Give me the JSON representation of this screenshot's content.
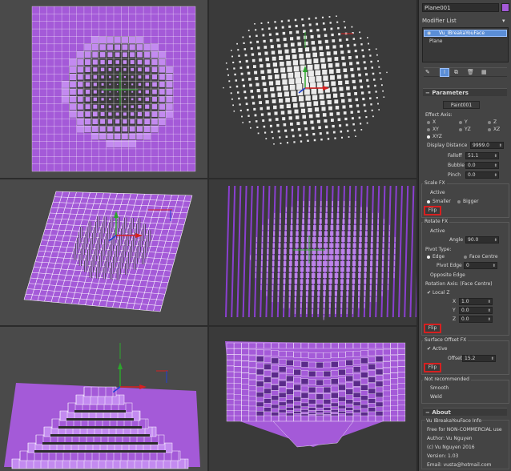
{
  "panel": {
    "object_name": "Plane001",
    "object_color": "#a45ad8",
    "modifier_list_label": "Modifier List",
    "stack": [
      "Vu_IBreakaYouFace",
      "Plane"
    ],
    "params_title": "Parameters",
    "paint_button": "Paint001",
    "effect_axis_label": "Effect Axis:",
    "axes": {
      "x": "X",
      "y": "Y",
      "z": "Z",
      "xy": "XY",
      "yz": "YZ",
      "xz": "XZ",
      "xyz": "XYZ"
    },
    "display_distance": {
      "label": "Display Distance",
      "value": "9999.0"
    },
    "falloff": {
      "label": "Falloff",
      "value": "51.1"
    },
    "bubble": {
      "label": "Bubble",
      "value": "0.0"
    },
    "pinch": {
      "label": "Pinch",
      "value": "0.0"
    },
    "scale_fx": {
      "title": "Scale FX",
      "active": "Active",
      "smaller": "Smaller",
      "bigger": "Bigger",
      "flip": "Flip"
    },
    "rotate_fx": {
      "title": "Rotate FX",
      "active": "Active",
      "angle_label": "Angle",
      "angle_value": "90.0",
      "pivot_type": "Pivot Type:",
      "edge": "Edge",
      "face_centre": "Face Centre",
      "pivot_edge_label": "Pivot Edge",
      "pivot_edge_value": "0",
      "opposite_edge": "Opposite Edge",
      "rotation_axis": "Rotation Axis: (Face Centre)",
      "local_z": "Local Z",
      "x_label": "X",
      "x_value": "1.0",
      "y_label": "Y",
      "y_value": "0.0",
      "z_label": "Z",
      "z_value": "0.0",
      "flip": "Flip"
    },
    "surface_offset_fx": {
      "title": "Surface Offset FX",
      "active": "Active",
      "offset_label": "Offset",
      "offset_value": "15.2",
      "flip": "Flip"
    },
    "not_recommended": {
      "title": "Not recommended",
      "smooth": "Smooth",
      "weld": "Weld"
    },
    "about": {
      "title": "About",
      "lines": [
        "Vu IBreakaYouFace Info",
        "Free for NON-COMMERCIAL use",
        "Author: Vu Nguyen",
        "(c) Vu Nguyen 2016",
        "Version: 1.03",
        "Email: vusta@hotmail.com"
      ]
    }
  },
  "colors": {
    "mesh": "#a45ad8",
    "mesh_light": "#c38af0",
    "wire": "#ffffff",
    "flip_border": "#d62020"
  }
}
